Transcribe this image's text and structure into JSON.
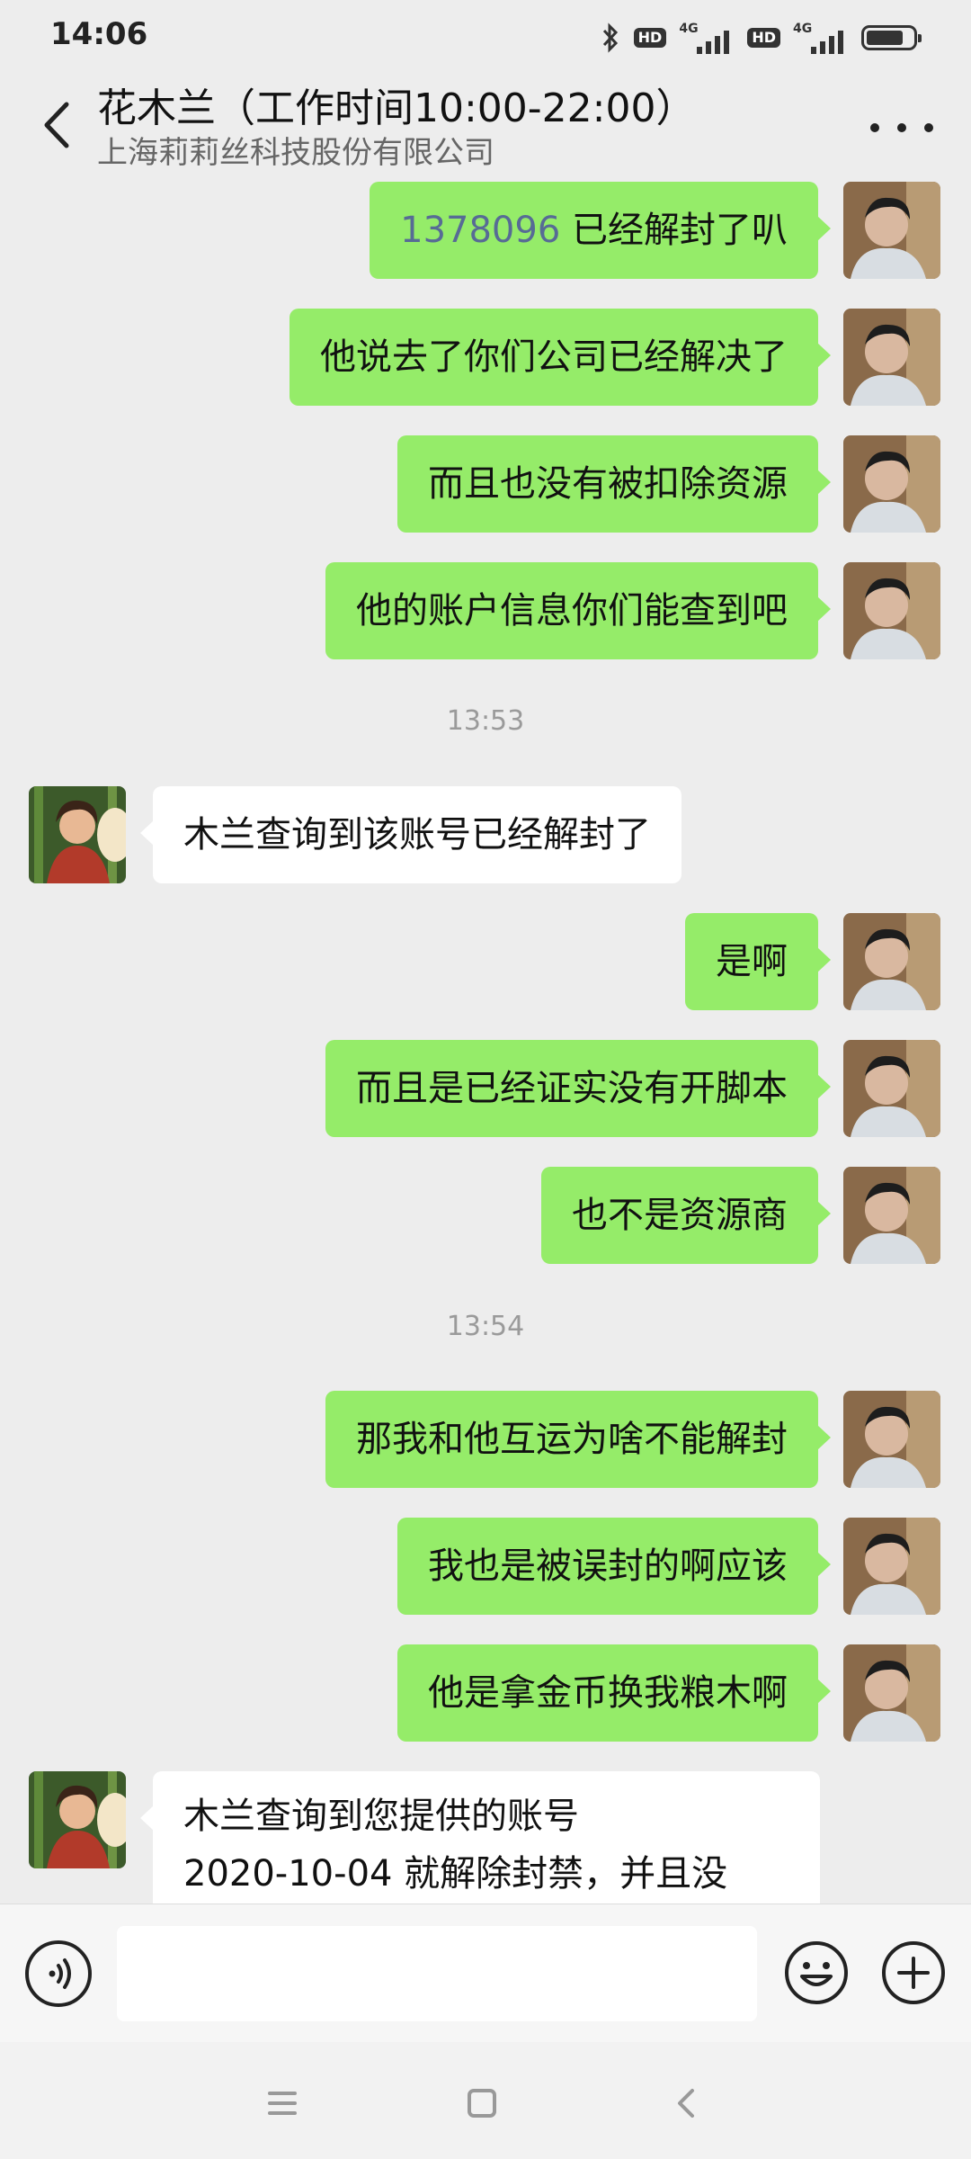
{
  "status_bar": {
    "time": "14:06",
    "hd1": "HD",
    "net1": "4G",
    "hd2": "HD",
    "net2": "4G",
    "bluetooth_icon": "bluetooth-icon",
    "battery_level": 0.72
  },
  "header": {
    "title": "花木兰（工作时间10:00-22:00）",
    "subtitle": "上海莉莉丝科技股份有限公司"
  },
  "messages": [
    {
      "side": "me",
      "prefix": "1378096",
      "text": " 已经解封了叭"
    },
    {
      "side": "me",
      "text": "他说去了你们公司已经解决了"
    },
    {
      "side": "me",
      "text": "而且也没有被扣除资源"
    },
    {
      "side": "me",
      "text": "他的账户信息你们能查到吧"
    },
    {
      "time": "13:53"
    },
    {
      "side": "other",
      "text": "木兰查询到该账号已经解封了"
    },
    {
      "side": "me",
      "text": "是啊"
    },
    {
      "side": "me",
      "text": "而且是已经证实没有开脚本"
    },
    {
      "side": "me",
      "text": "也不是资源商"
    },
    {
      "time": "13:54"
    },
    {
      "side": "me",
      "text": "那我和他互运为啥不能解封"
    },
    {
      "side": "me",
      "text": "我也是被误封的啊应该"
    },
    {
      "side": "me",
      "text": "他是拿金币换我粮木啊"
    },
    {
      "side": "other",
      "line1": "木兰查询到您提供的账号",
      "line2": "2020-10-04 就解除封禁，并且没"
    }
  ],
  "input": {
    "placeholder": ""
  },
  "colors": {
    "my_bubble": "#95ec69",
    "other_bubble": "#ffffff",
    "background": "#ededed",
    "link_number": "#576b95"
  }
}
